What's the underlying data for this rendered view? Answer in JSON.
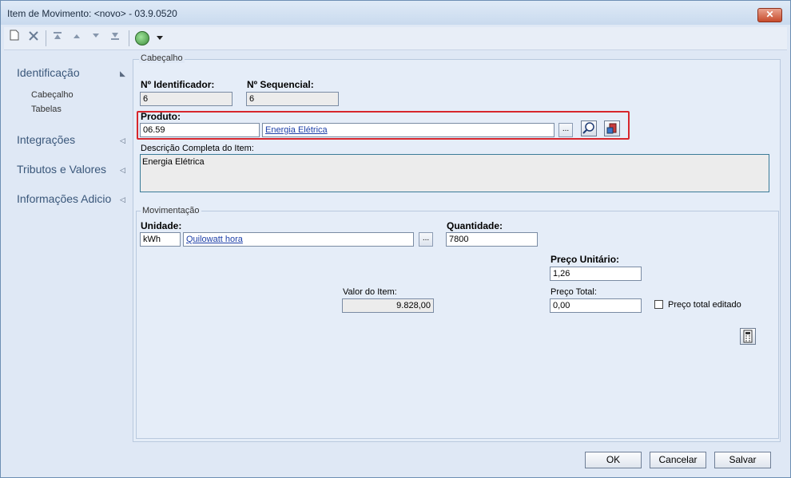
{
  "window": {
    "title": "Item de Movimento: <novo> - 03.9.0520",
    "close_glyph": "✕"
  },
  "toolbar": {
    "icons": [
      "new-document-icon",
      "delete-icon",
      "first-record-icon",
      "previous-record-icon",
      "next-record-icon",
      "last-record-icon",
      "globe-icon",
      "dropdown-arrow-icon"
    ]
  },
  "nav": {
    "sections": [
      {
        "label": "Identificação",
        "subitems": [
          "Cabeçalho",
          "Tabelas"
        ]
      },
      {
        "label": "Integrações"
      },
      {
        "label": "Tributos e Valores"
      },
      {
        "label": "Informações Adicio"
      }
    ]
  },
  "cabecalho": {
    "title": "Cabeçalho",
    "id_label": "Nº Identificador:",
    "id_value": "6",
    "seq_label": "Nº Sequencial:",
    "seq_value": "6",
    "produto_label": "Produto:",
    "produto_code": "06.59",
    "produto_name": "Energia Elétrica",
    "produto_dots": "...",
    "descricao_label": "Descrição Completa do Item:",
    "descricao_value": "Energia Elétrica"
  },
  "movimentacao": {
    "title": "Movimentação",
    "unidade_label": "Unidade:",
    "unidade_code": "kWh",
    "unidade_name": "Quilowatt hora",
    "unidade_dots": "...",
    "quantidade_label": "Quantidade:",
    "quantidade_value": "7800",
    "preco_unitario_label": "Preço Unitário:",
    "preco_unitario_value": "1,26",
    "valor_item_label": "Valor do Item:",
    "valor_item_value": "9.828,00",
    "preco_total_label": "Preço Total:",
    "preco_total_value": "0,00",
    "preco_total_editado_label": "Preço total editado",
    "preco_total_editado_checked": false
  },
  "buttons": {
    "ok": "OK",
    "cancel": "Cancelar",
    "save": "Salvar"
  }
}
